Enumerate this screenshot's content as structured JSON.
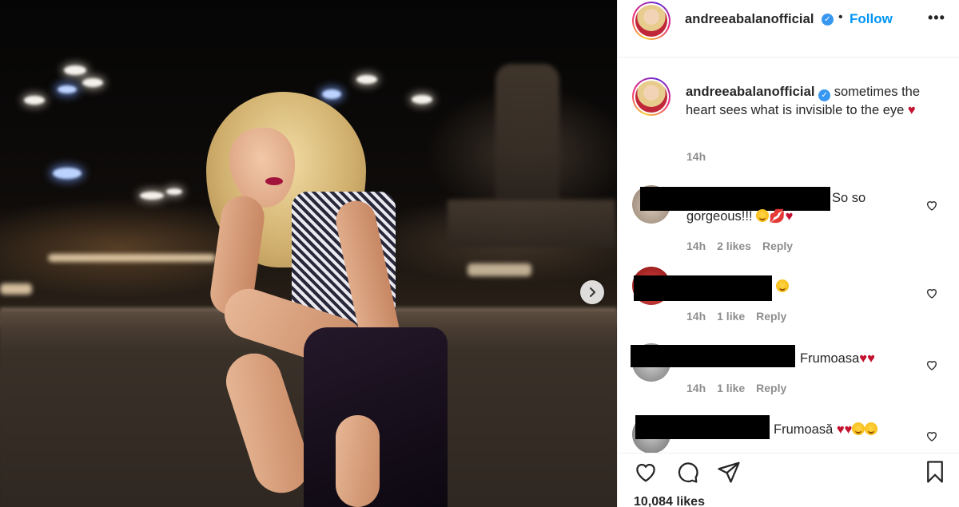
{
  "post": {
    "username": "andreeabalanofficial",
    "follow_label": "Follow",
    "more_label": "•••",
    "caption": "sometimes the heart sees what is invisible to the eye",
    "caption_time": "14h",
    "likes": "10,084 likes"
  },
  "comments": [
    {
      "text": "So so gorgeous!!!",
      "time": "14h",
      "likes": "2 likes",
      "reply": "Reply"
    },
    {
      "text": "",
      "time": "14h",
      "likes": "1 like",
      "reply": "Reply"
    },
    {
      "text": "Frumoasa",
      "time": "14h",
      "likes": "1 like",
      "reply": "Reply"
    },
    {
      "text": "Frumoasă",
      "time": "",
      "likes": "",
      "reply": ""
    }
  ],
  "icons": {
    "verified": "verified-badge-icon",
    "next": "chevron-right-icon",
    "like": "heart-icon",
    "comment": "comment-icon",
    "share": "paper-plane-icon",
    "save": "bookmark-icon"
  },
  "colors": {
    "accent": "#0095f6",
    "verified": "#3897f0",
    "muted": "#8e8e8e",
    "heart": "#c4112f"
  }
}
